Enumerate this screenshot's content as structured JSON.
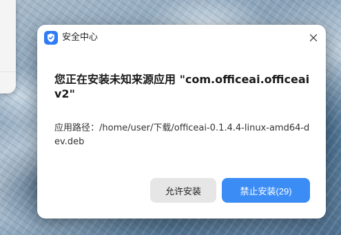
{
  "dialog": {
    "app_name": "安全中心",
    "headline": "您正在安装未知来源应用 \"com.officeai.officeaiv2\"",
    "path_label": "应用路径：",
    "path_value": "/home/user/下载/officeai-0.1.4.4-linux-amd64-dev.deb",
    "buttons": {
      "allow_label": "允许安装",
      "deny_label": "禁止安装(29)"
    },
    "icons": {
      "app": "shield-check-icon",
      "close": "close-icon"
    },
    "colors": {
      "accent": "#3b8cf5",
      "app_icon": "#2e7cf6",
      "secondary_button": "#e6e6e6"
    }
  }
}
